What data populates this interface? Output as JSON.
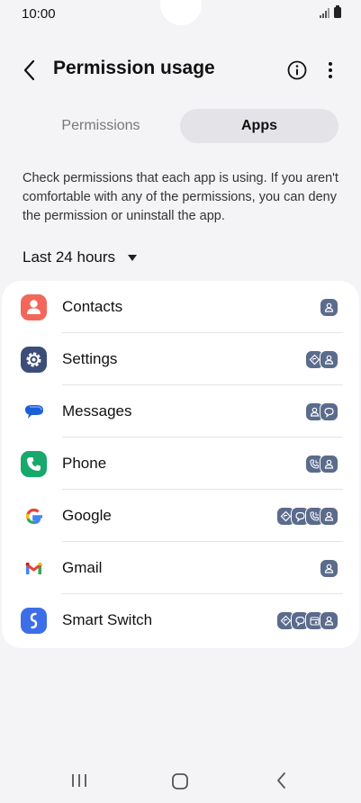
{
  "status_bar": {
    "time": "10:00"
  },
  "header": {
    "title": "Permission usage"
  },
  "tabs": [
    {
      "label": "Permissions",
      "selected": false
    },
    {
      "label": "Apps",
      "selected": true
    }
  ],
  "description": "Check permissions that each app is using. If you aren't comfortable with any of the permissions, you can deny the permission or uninstall the app.",
  "period": {
    "label": "Last 24 hours"
  },
  "apps": [
    {
      "name": "Contacts",
      "icon": "contacts-icon",
      "permissions": [
        "contacts-icon"
      ]
    },
    {
      "name": "Settings",
      "icon": "settings-icon",
      "permissions": [
        "location-icon",
        "contacts-icon"
      ]
    },
    {
      "name": "Messages",
      "icon": "messages-icon",
      "permissions": [
        "contacts-icon",
        "sms-icon"
      ]
    },
    {
      "name": "Phone",
      "icon": "phone-icon",
      "permissions": [
        "call-log-icon",
        "contacts-icon"
      ]
    },
    {
      "name": "Google",
      "icon": "google-icon",
      "permissions": [
        "location-icon",
        "sms-icon",
        "call-log-icon",
        "contacts-icon"
      ]
    },
    {
      "name": "Gmail",
      "icon": "gmail-icon",
      "permissions": [
        "contacts-icon"
      ]
    },
    {
      "name": "Smart Switch",
      "icon": "smart-switch-icon",
      "permissions": [
        "location-icon",
        "sms-icon",
        "calendar-icon",
        "contacts-icon"
      ]
    }
  ],
  "colors": {
    "background": "#f4f4f6",
    "card": "#ffffff",
    "badge": "#5b6b8c",
    "tab_selected": "#e4e4e8"
  }
}
